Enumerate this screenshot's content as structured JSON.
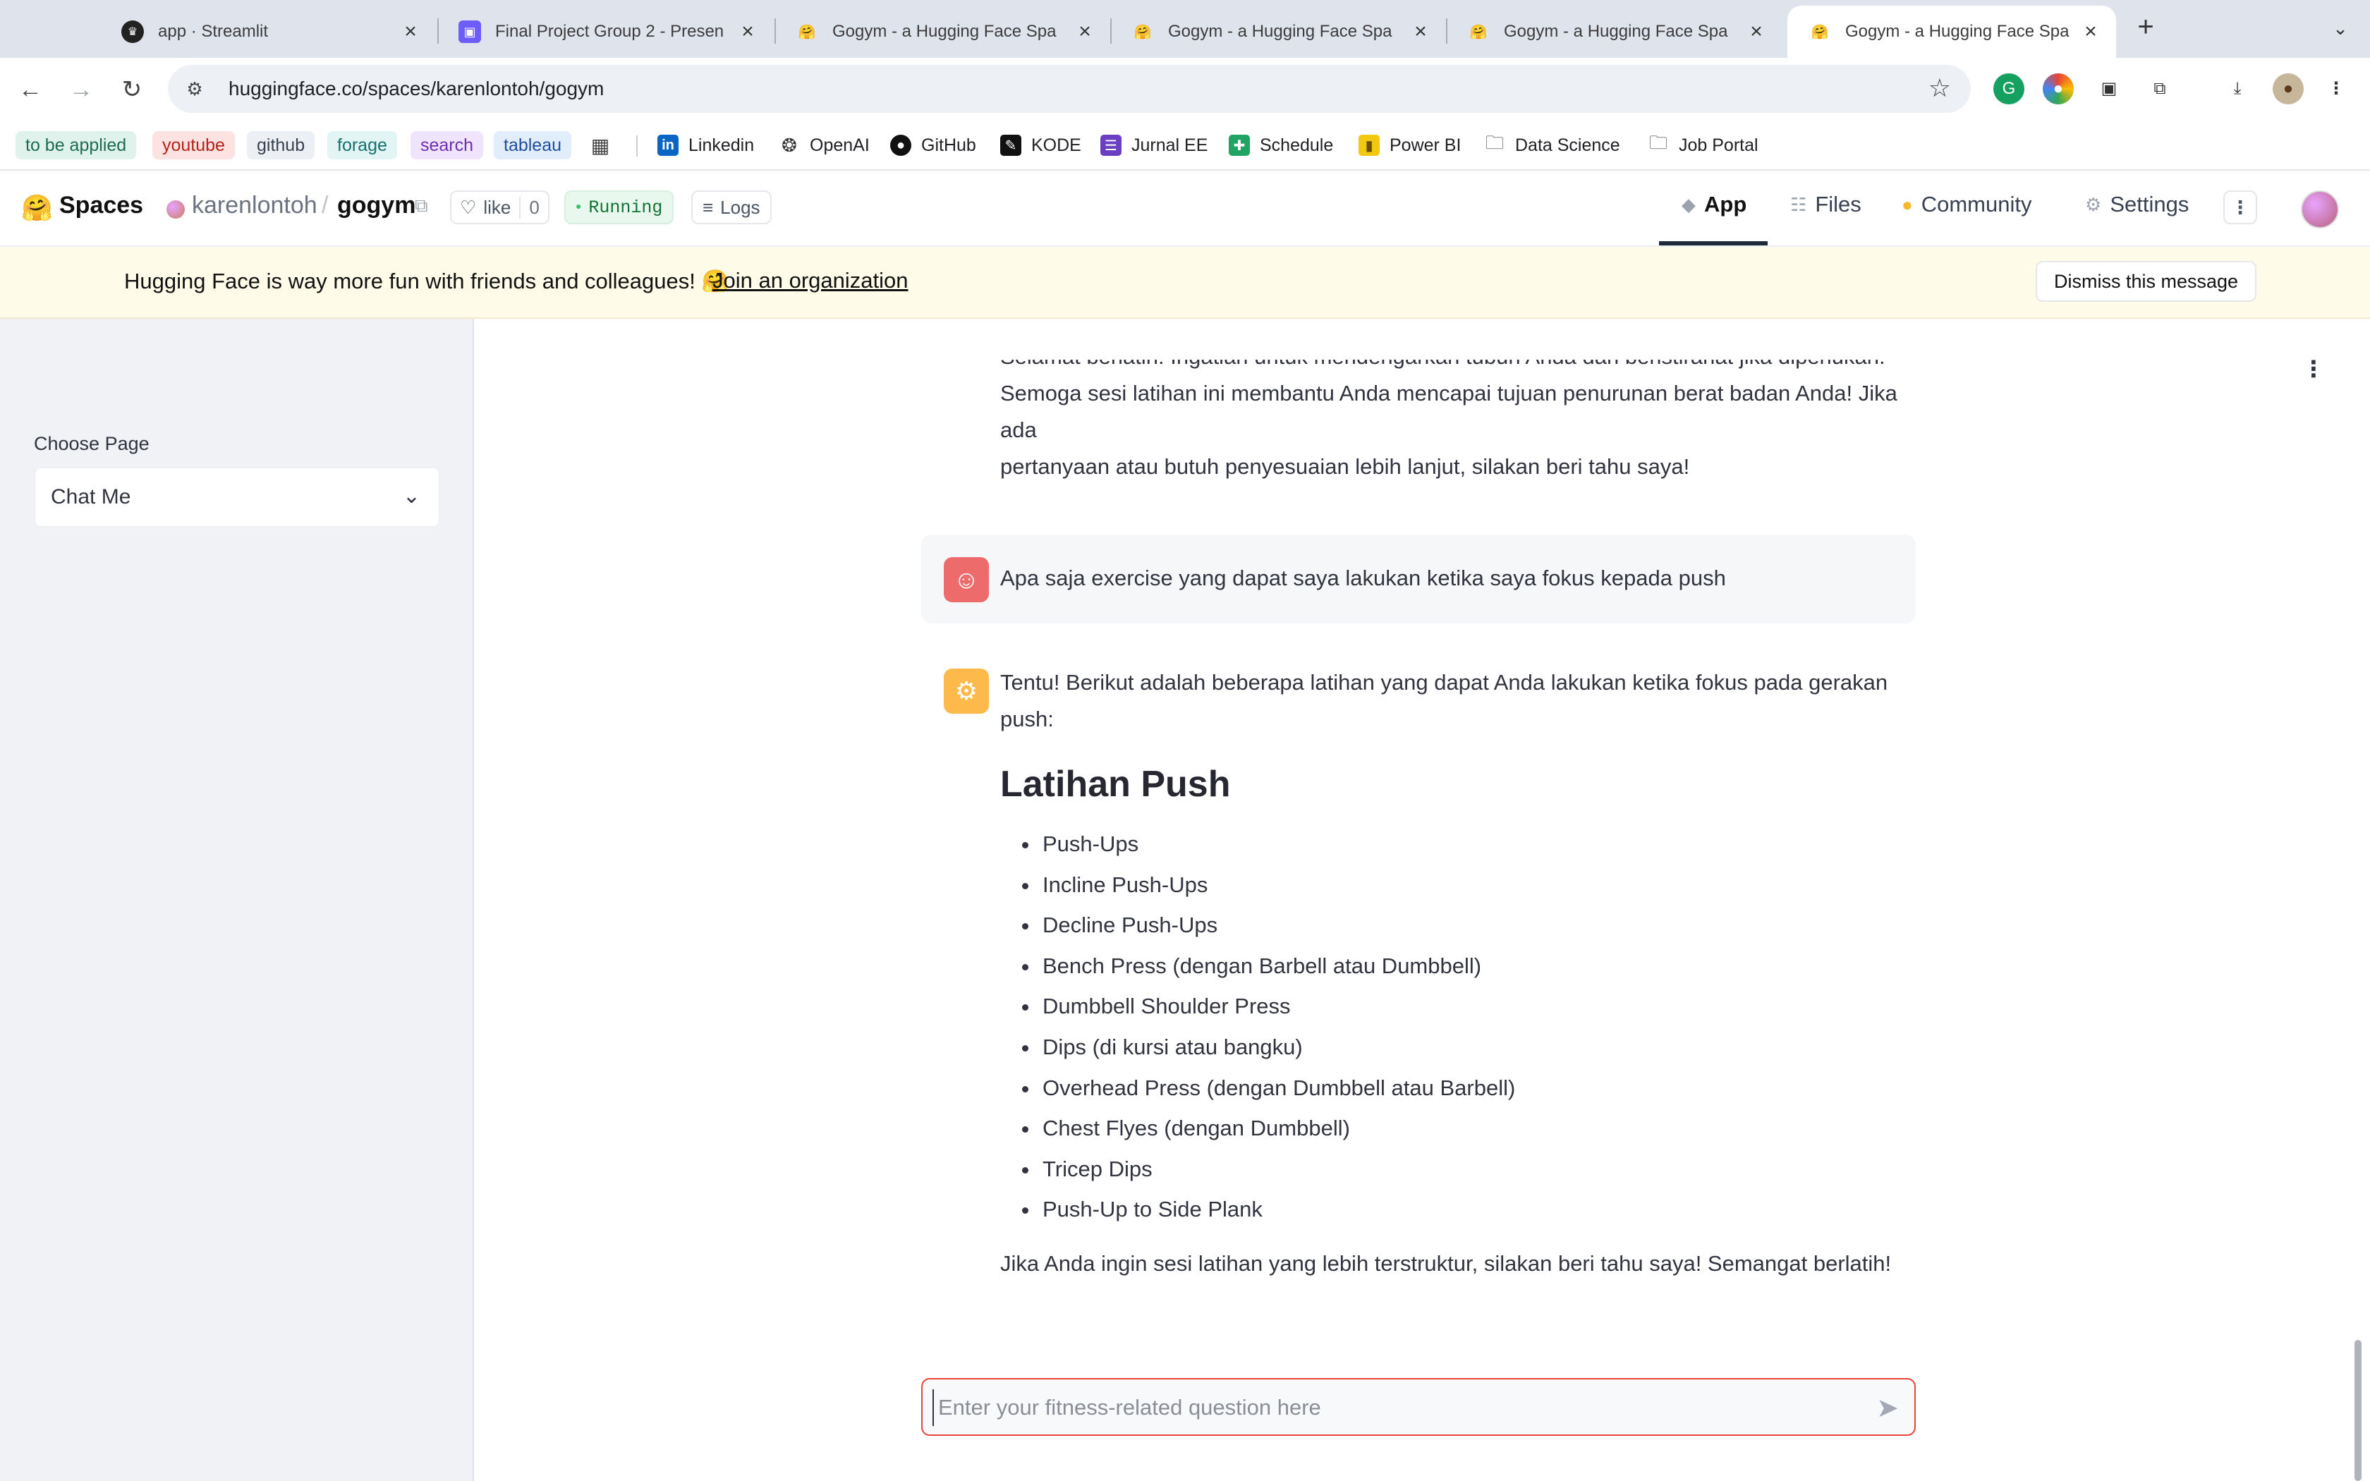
{
  "browser": {
    "tabs": [
      {
        "title": "app · Streamlit",
        "icon": "streamlit-icon"
      },
      {
        "title": "Final Project Group 2 - Presen",
        "icon": "slides-icon"
      },
      {
        "title": "Gogym - a Hugging Face Spa",
        "icon": "huggingface-icon"
      },
      {
        "title": "Gogym - a Hugging Face Spa",
        "icon": "huggingface-icon"
      },
      {
        "title": "Gogym - a Hugging Face Spa",
        "icon": "huggingface-icon"
      },
      {
        "title": "Gogym - a Hugging Face Spa",
        "icon": "huggingface-icon"
      }
    ],
    "url": "huggingface.co/spaces/karenlontoh/gogym",
    "bookmark_chips": [
      {
        "label": "to be applied",
        "color": "#e0f2ec",
        "text_color": "#1c6b52"
      },
      {
        "label": "youtube",
        "color": "#fde2e2",
        "text_color": "#b42318"
      },
      {
        "label": "github",
        "color": "#eceff3",
        "text_color": "#374151"
      },
      {
        "label": "forage",
        "color": "#e3f4f4",
        "text_color": "#17706e"
      },
      {
        "label": "search",
        "color": "#efe4fb",
        "text_color": "#6b2fb3"
      },
      {
        "label": "tableau",
        "color": "#e2edfb",
        "text_color": "#1e4e9e"
      }
    ],
    "bookmarks": [
      {
        "label": "Linkedin",
        "icon": "linkedin-icon"
      },
      {
        "label": "OpenAI",
        "icon": "openai-icon"
      },
      {
        "label": "GitHub",
        "icon": "github-icon"
      },
      {
        "label": "KODE",
        "icon": "kode-icon"
      },
      {
        "label": "Jurnal EE",
        "icon": "jurnal-icon"
      },
      {
        "label": "Schedule",
        "icon": "schedule-icon"
      },
      {
        "label": "Power BI",
        "icon": "powerbi-icon"
      },
      {
        "label": "Data Science",
        "icon": "folder-icon"
      },
      {
        "label": "Job Portal",
        "icon": "folder-icon"
      }
    ]
  },
  "hf": {
    "spaces_label": "Spaces",
    "owner": "karenlontoh",
    "slash": "/",
    "repo": "gogym",
    "like_label": "like",
    "like_count": "0",
    "status": "Running",
    "logs_label": "Logs",
    "nav": {
      "app": "App",
      "files": "Files",
      "community": "Community",
      "settings": "Settings"
    },
    "banner_text": "Hugging Face is way more fun with friends and colleagues! 🤗",
    "banner_link": "Join an organization",
    "dismiss": "Dismiss this message"
  },
  "sidebar": {
    "choose_label": "Choose Page",
    "selected_page": "Chat Me"
  },
  "chat": {
    "prev_tail_cut": "Selamat berlatih! Ingatlah untuk mendengarkan tubuh Anda dan beristirahat jika diperlukan.",
    "prev_tail_1": "Semoga sesi latihan ini membantu Anda mencapai tujuan penurunan berat badan Anda! Jika ada",
    "prev_tail_2": "pertanyaan atau butuh penyesuaian lebih lanjut, silakan beri tahu saya!",
    "user_message": "Apa saja exercise yang dapat saya lakukan ketika saya fokus kepada push",
    "assistant_intro_1": "Tentu! Berikut adalah beberapa latihan yang dapat Anda lakukan ketika fokus pada gerakan",
    "assistant_intro_2": "push:",
    "heading": "Latihan Push",
    "items": [
      "Push-Ups",
      "Incline Push-Ups",
      "Decline Push-Ups",
      "Bench Press (dengan Barbell atau Dumbbell)",
      "Dumbbell Shoulder Press",
      "Dips (di kursi atau bangku)",
      "Overhead Press (dengan Dumbbell atau Barbell)",
      "Chest Flyes (dengan Dumbbell)",
      "Tricep Dips",
      "Push-Up to Side Plank"
    ],
    "closing": "Jika Anda ingin sesi latihan yang lebih terstruktur, silakan beri tahu saya! Semangat berlatih!",
    "input_placeholder": "Enter your fitness-related question here"
  },
  "colors": {
    "user_avatar": "#ee6b6b",
    "assistant_avatar": "#fdb949",
    "input_border": "#e8433c",
    "running_badge": "#e9f8ef"
  }
}
